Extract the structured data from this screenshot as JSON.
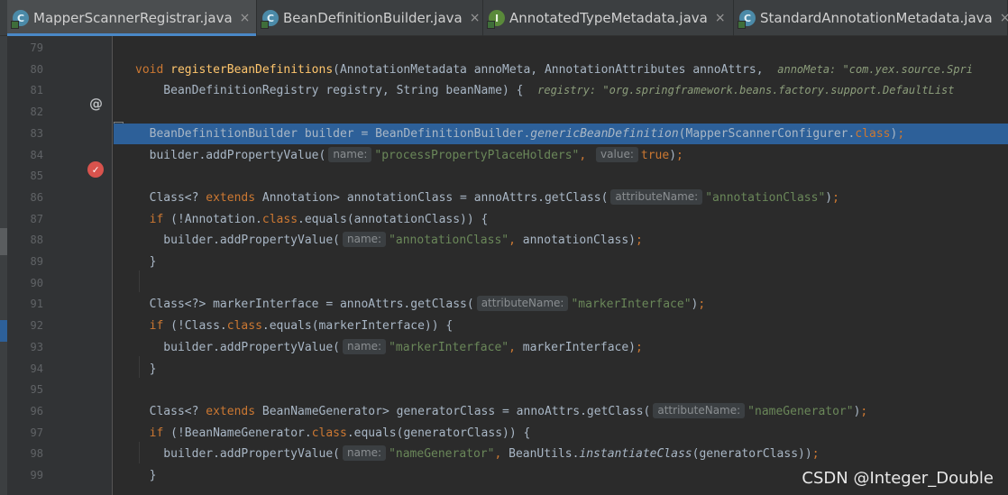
{
  "tabs": [
    {
      "label": "MapperScannerRegistrar.java",
      "icon": "class-icon",
      "icon_letter": "C",
      "active": true
    },
    {
      "label": "BeanDefinitionBuilder.java",
      "icon": "class-icon",
      "icon_letter": "C",
      "active": false
    },
    {
      "label": "AnnotatedTypeMetadata.java",
      "icon": "interface-icon",
      "icon_letter": "I",
      "active": false
    },
    {
      "label": "StandardAnnotationMetadata.java",
      "icon": "class-icon",
      "icon_letter": "C",
      "active": false
    }
  ],
  "close_glyph": "×",
  "gutter": {
    "override_marker": "@",
    "breakpoint_glyph": "✓"
  },
  "lines": [
    {
      "num": "79",
      "html": ""
    },
    {
      "num": "80",
      "html": "<span class=\"kw\">void </span><span class=\"fn\">registerBeanDefinitions</span>(AnnotationMetadata annoMeta, AnnotationAttributes annoAttrs,  <span class=\"val\">annoMeta: \"com.yex.source.Spri</span>"
    },
    {
      "num": "81",
      "html": "    BeanDefinitionRegistry registry, String beanName) {  <span class=\"val\">registry: \"org.springframework.beans.factory.support.DefaultList</span>"
    },
    {
      "num": "82",
      "html": ""
    },
    {
      "num": "83",
      "html": "  BeanDefinitionBuilder builder = BeanDefinitionBuilder.<span class=\"it\">genericBeanDefinition</span>(MapperScannerConfigurer.<span class=\"kw\">class</span>)<span class=\"kw\">;</span>"
    },
    {
      "num": "84",
      "html": "  builder.addPropertyValue(<span class=\"hint\">name:</span><span class=\"str\">\"processPropertyPlaceHolders\"</span><span class=\"kw\">,</span> <span class=\"hint\">value:</span><span class=\"kw\">true</span>)<span class=\"kw\">;</span>"
    },
    {
      "num": "85",
      "html": ""
    },
    {
      "num": "86",
      "html": "  Class&lt;? <span class=\"kw\">extends </span>Annotation&gt; annotationClass = annoAttrs.getClass(<span class=\"hint\">attributeName:</span><span class=\"str\">\"annotationClass\"</span>)<span class=\"kw\">;</span>"
    },
    {
      "num": "87",
      "html": "  <span class=\"kw\">if </span>(!Annotation.<span class=\"kw\">class</span>.equals(annotationClass)) {"
    },
    {
      "num": "88",
      "html": "    builder.addPropertyValue(<span class=\"hint\">name:</span><span class=\"str\">\"annotationClass\"</span><span class=\"kw\">,</span> annotationClass)<span class=\"kw\">;</span>"
    },
    {
      "num": "89",
      "html": "  }"
    },
    {
      "num": "90",
      "html": ""
    },
    {
      "num": "91",
      "html": "  Class&lt;?&gt; markerInterface = annoAttrs.getClass(<span class=\"hint\">attributeName:</span><span class=\"str\">\"markerInterface\"</span>)<span class=\"kw\">;</span>"
    },
    {
      "num": "92",
      "html": "  <span class=\"kw\">if </span>(!Class.<span class=\"kw\">class</span>.equals(markerInterface)) {"
    },
    {
      "num": "93",
      "html": "    builder.addPropertyValue(<span class=\"hint\">name:</span><span class=\"str\">\"markerInterface\"</span><span class=\"kw\">,</span> markerInterface)<span class=\"kw\">;</span>"
    },
    {
      "num": "94",
      "html": "  }"
    },
    {
      "num": "95",
      "html": ""
    },
    {
      "num": "96",
      "html": "  Class&lt;? <span class=\"kw\">extends </span>BeanNameGenerator&gt; generatorClass = annoAttrs.getClass(<span class=\"hint\">attributeName:</span><span class=\"str\">\"nameGenerator\"</span>)<span class=\"kw\">;</span>"
    },
    {
      "num": "97",
      "html": "  <span class=\"kw\">if </span>(!BeanNameGenerator.<span class=\"kw\">class</span>.equals(generatorClass)) {"
    },
    {
      "num": "98",
      "html": "    builder.addPropertyValue(<span class=\"hint\">name:</span><span class=\"str\">\"nameGenerator\"</span><span class=\"kw\">,</span> BeanUtils.<span class=\"it\">instantiateClass</span>(generatorClass))<span class=\"kw\">;</span>"
    },
    {
      "num": "99",
      "html": "  }"
    }
  ],
  "highlighted_line": "83",
  "watermark": "CSDN @Integer_Double"
}
